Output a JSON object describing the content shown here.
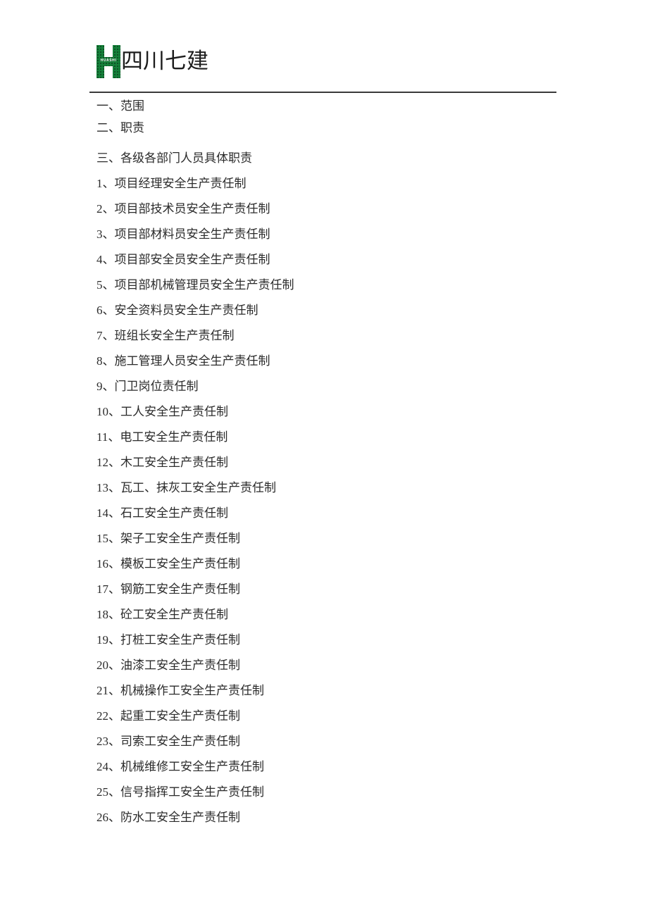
{
  "document": {
    "background_color": "#ffffff",
    "text_color": "#2b2b2b",
    "rule_color": "#3a3a3a"
  },
  "header": {
    "logo": {
      "icon_name": "huashi-h-logo",
      "mark_text": "HUASHI",
      "green": "#15803a"
    },
    "wordmark": "四川七建"
  },
  "toc": {
    "sections": [
      {
        "text": "一、范围",
        "spacing": "first"
      },
      {
        "text": "二、职责",
        "spacing": "gap-tight"
      },
      {
        "text": "三、各级各部门人员具体职责",
        "spacing": "gap-wide"
      }
    ],
    "items": [
      {
        "text": "1、项目经理安全生产责任制"
      },
      {
        "text": "2、项目部技术员安全生产责任制"
      },
      {
        "text": "3、项目部材料员安全生产责任制"
      },
      {
        "text": "4、项目部安全员安全生产责任制"
      },
      {
        "text": "5、项目部机械管理员安全生产责任制"
      },
      {
        "text": "6、安全资料员安全生产责任制"
      },
      {
        "text": "7、班组长安全生产责任制"
      },
      {
        "text": "8、施工管理人员安全生产责任制"
      },
      {
        "text": "9、门卫岗位责任制"
      },
      {
        "text": "10、工人安全生产责任制"
      },
      {
        "text": "11、电工安全生产责任制"
      },
      {
        "text": "12、木工安全生产责任制"
      },
      {
        "text": "13、瓦工、抹灰工安全生产责任制"
      },
      {
        "text": "14、石工安全生产责任制"
      },
      {
        "text": "15、架子工安全生产责任制"
      },
      {
        "text": "16、模板工安全生产责任制"
      },
      {
        "text": "17、钢筋工安全生产责任制"
      },
      {
        "text": "18、砼工安全生产责任制"
      },
      {
        "text": "19、打桩工安全生产责任制"
      },
      {
        "text": "20、油漆工安全生产责任制"
      },
      {
        "text": "21、机械操作工安全生产责任制"
      },
      {
        "text": "22、起重工安全生产责任制"
      },
      {
        "text": "23、司索工安全生产责任制"
      },
      {
        "text": "24、机械维修工安全生产责任制"
      },
      {
        "text": "25、信号指挥工安全生产责任制"
      },
      {
        "text": "26、防水工安全生产责任制"
      }
    ]
  }
}
